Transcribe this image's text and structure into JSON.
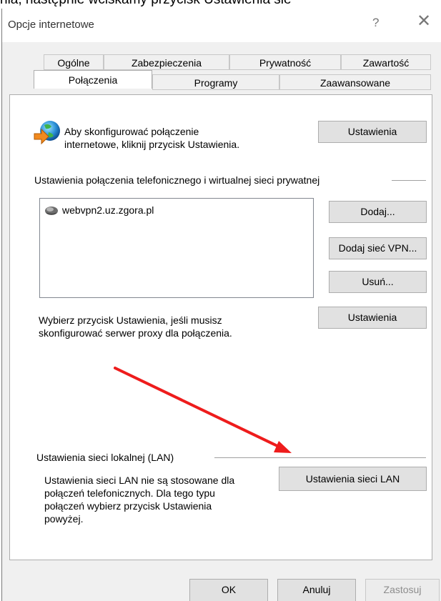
{
  "background_caption": "nia, następnie wciskamy przycisk Ustawienia sie",
  "window": {
    "title": "Opcje internetowe",
    "help_glyph": "?",
    "close_glyph": "✕"
  },
  "tabs": {
    "row1": [
      "Ogólne",
      "Zabezpieczenia",
      "Prywatność",
      "Zawartość"
    ],
    "row2": [
      "Połączenia",
      "Programy",
      "Zaawansowane"
    ],
    "active": "Połączenia"
  },
  "connection": {
    "setup_text_line1": "Aby skonfigurować połączenie",
    "setup_text_line2": "internetowe, kliknij przycisk Ustawienia.",
    "setup_button": "Ustawienia"
  },
  "dialup_vpn": {
    "section_title": "Ustawienia połączenia telefonicznego i wirtualnej sieci prywatnej",
    "connections": [
      "webvpn2.uz.zgora.pl"
    ],
    "add_button": "Dodaj...",
    "add_vpn_button": "Dodaj sieć VPN...",
    "remove_button": "Usuń...",
    "proxy_text_line1": "Wybierz przycisk Ustawienia, jeśli musisz",
    "proxy_text_line2": "skonfigurować serwer proxy dla połączenia.",
    "settings_button": "Ustawienia"
  },
  "lan": {
    "section_title": "Ustawienia sieci lokalnej (LAN)",
    "text_line1": "Ustawienia sieci LAN nie są stosowane dla",
    "text_line2": "połączeń telefonicznych. Dla tego typu",
    "text_line3": "połączeń wybierz przycisk Ustawienia",
    "text_line4": "powyżej.",
    "lan_button": "Ustawienia sieci LAN"
  },
  "footer": {
    "ok": "OK",
    "cancel": "Anuluj",
    "apply": "Zastosuj"
  },
  "colors": {
    "annotation_arrow": "#ee1c1c"
  }
}
